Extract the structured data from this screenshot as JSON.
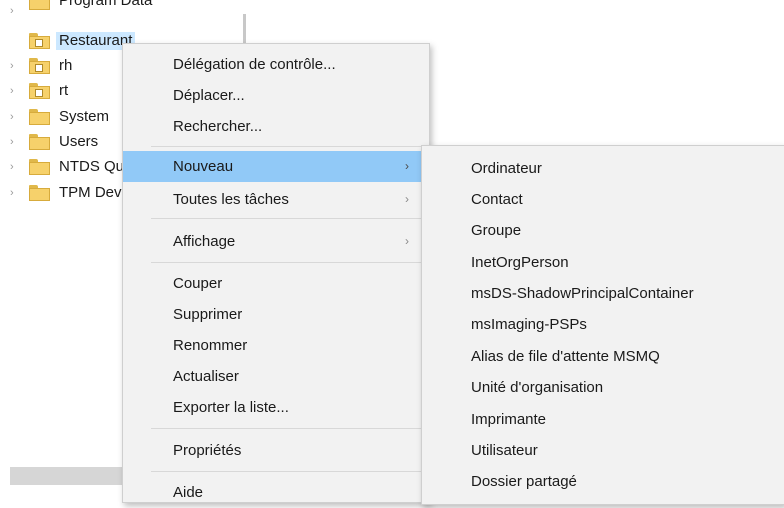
{
  "tree": {
    "items": [
      {
        "label": "Program Data",
        "icon": "folder-icon",
        "expander": "›"
      },
      {
        "label": "Restaurant",
        "icon": "ou-folder-icon",
        "expander": "",
        "selected": true
      },
      {
        "label": "rh",
        "icon": "ou-folder-icon",
        "expander": "›"
      },
      {
        "label": "rt",
        "icon": "ou-folder-icon",
        "expander": "›"
      },
      {
        "label": "System",
        "icon": "folder-icon",
        "expander": "›"
      },
      {
        "label": "Users",
        "icon": "folder-icon",
        "expander": "›"
      },
      {
        "label": "NTDS Quotas",
        "icon": "folder-icon",
        "expander": "›"
      },
      {
        "label": "TPM Devices",
        "icon": "folder-icon",
        "expander": "›"
      }
    ]
  },
  "context_menu": {
    "items": [
      {
        "label": "Délégation de contrôle...",
        "submenu": false
      },
      {
        "label": "Déplacer...",
        "submenu": false
      },
      {
        "label": "Rechercher...",
        "submenu": false
      },
      {
        "label": "Nouveau",
        "submenu": true,
        "highlighted": true
      },
      {
        "label": "Toutes les tâches",
        "submenu": true
      },
      {
        "label": "Affichage",
        "submenu": true
      },
      {
        "label": "Couper",
        "submenu": false
      },
      {
        "label": "Supprimer",
        "submenu": false
      },
      {
        "label": "Renommer",
        "submenu": false
      },
      {
        "label": "Actualiser",
        "submenu": false
      },
      {
        "label": "Exporter la liste...",
        "submenu": false
      },
      {
        "label": "Propriétés",
        "submenu": false
      },
      {
        "label": "Aide",
        "submenu": false
      }
    ],
    "arrow_glyph": "›"
  },
  "submenu": {
    "items": [
      "Ordinateur",
      "Contact",
      "Groupe",
      "InetOrgPerson",
      "msDS-ShadowPrincipalContainer",
      "msImaging-PSPs",
      "Alias de file d'attente MSMQ",
      "Unité d'organisation",
      "Imprimante",
      "Utilisateur",
      "Dossier partagé"
    ]
  },
  "colors": {
    "highlight": "#91c9f7",
    "selection": "#cce8ff",
    "menu_bg": "#f2f2f2",
    "folder": "#f6d16b"
  }
}
